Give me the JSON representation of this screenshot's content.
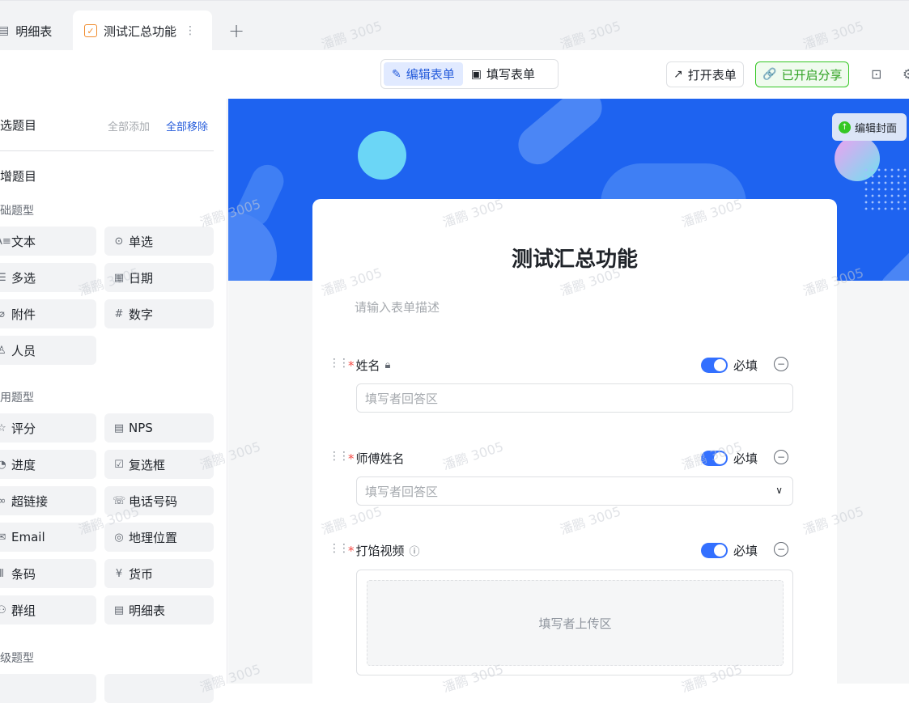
{
  "tabs": [
    {
      "label": "明细表",
      "icon": "table-icon"
    },
    {
      "label": "测试汇总功能",
      "icon": "form-checklist-icon",
      "active": true
    }
  ],
  "toolbar": {
    "edit_form": "编辑表单",
    "fill_form": "填写表单",
    "open_form": "打开表单",
    "share_on": "已开启分享"
  },
  "sidebar": {
    "selected_header": "选题目",
    "add_all": "全部添加",
    "remove_all": "全部移除",
    "new_question": "增题目",
    "categories": {
      "basic": "础题型",
      "common": "用题型",
      "advanced": "级题型"
    },
    "basic_fields": [
      "文本",
      "单选",
      "多选",
      "日期",
      "附件",
      "数字",
      "人员"
    ],
    "common_fields": [
      "评分",
      "NPS",
      "进度",
      "复选框",
      "超链接",
      "电话号码",
      "Email",
      "地理位置",
      "条码",
      "货币",
      "群组",
      "明细表"
    ]
  },
  "cover": {
    "edit_cover": "编辑封面"
  },
  "form": {
    "title": "测试汇总功能",
    "description_placeholder": "请输入表单描述",
    "required_label": "必填",
    "questions": [
      {
        "label": "姓名",
        "placeholder": "填写者回答区",
        "type": "text"
      },
      {
        "label": "师傅姓名",
        "placeholder": "填写者回答区",
        "type": "select"
      },
      {
        "label": "打馅视频",
        "placeholder": "填写者上传区",
        "type": "upload"
      }
    ]
  },
  "watermark": "潘鹏 3005",
  "colors": {
    "primary": "#3370ff",
    "cover": "#1e63f0",
    "share_green": "#2ea121",
    "required": "#f54a45"
  }
}
